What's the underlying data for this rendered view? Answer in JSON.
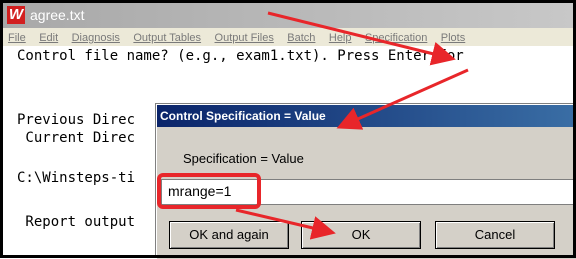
{
  "window": {
    "title": "agree.txt",
    "icon_letter": "W"
  },
  "menu": [
    "File",
    "Edit",
    "Diagnosis",
    "Output Tables",
    "Output Files",
    "Batch",
    "Help",
    "Specification",
    "Plots"
  ],
  "console": {
    "lines": [
      "Control file name? (e.g., exam1.txt). Press Enter for",
      "Previous Direc",
      " Current Direc",
      "C:\\Winsteps-ti",
      " Report output"
    ]
  },
  "dialog": {
    "title": "Control Specification = Value",
    "label": "Specification = Value",
    "input_value": "mrange=1",
    "buttons": {
      "again": "OK and again",
      "ok": "OK",
      "cancel": "Cancel"
    }
  },
  "annotation_colors": {
    "arrow": "#e8262a"
  }
}
